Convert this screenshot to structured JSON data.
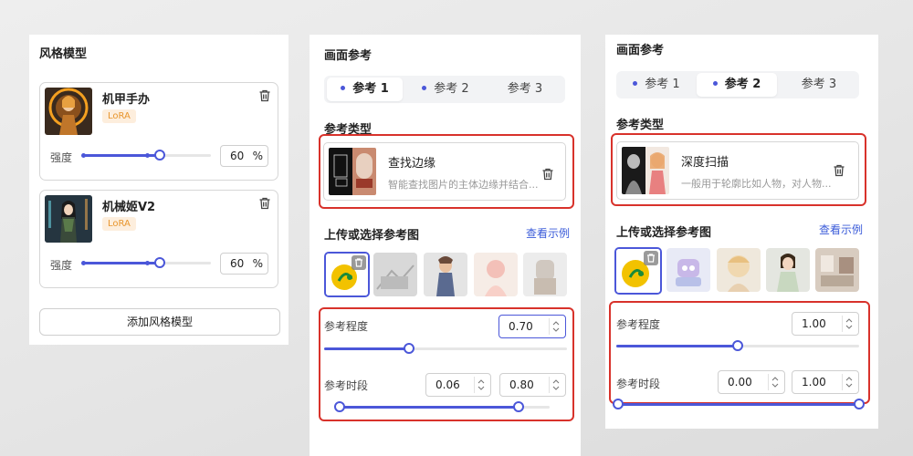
{
  "panel1": {
    "title": "风格模型",
    "strength_label": "强度",
    "percent_unit": "%",
    "models": [
      {
        "name": "机甲手办",
        "badge": "LoRA",
        "strength": "60",
        "strength_fraction": 0.6
      },
      {
        "name": "机械姬V2",
        "badge": "LoRA",
        "strength": "60",
        "strength_fraction": 0.6
      }
    ],
    "add_button": "添加风格模型"
  },
  "panel2": {
    "title": "画面参考",
    "tabs": [
      "参考 1",
      "参考 2",
      "参考 3"
    ],
    "active_tab": 0,
    "type_label": "参考类型",
    "type_title": "查找边缘",
    "type_desc": "智能查找图片的主体边缘并结合...",
    "upload_label": "上传或选择参考图",
    "view_example": "查看示例",
    "degree_label": "参考程度",
    "degree_value": "0.70",
    "period_label": "参考时段",
    "period_start": "0.06",
    "period_end": "0.80"
  },
  "panel3": {
    "title": "画面参考",
    "tabs": [
      "参考 1",
      "参考 2",
      "参考 3"
    ],
    "active_tab": 1,
    "type_label": "参考类型",
    "type_title": "深度扫描",
    "type_desc": "一般用于轮廓比如人物，对人物...",
    "upload_label": "上传或选择参考图",
    "view_example": "查看示例",
    "degree_label": "参考程度",
    "degree_value": "1.00",
    "period_label": "参考时段",
    "period_start": "0.00",
    "period_end": "1.00"
  },
  "colors": {
    "accent": "#4b57d9",
    "highlight_box": "#d8322b",
    "lora_badge_bg": "#fdeedd",
    "lora_badge_text": "#e8962e",
    "link": "#3a5bd9"
  }
}
